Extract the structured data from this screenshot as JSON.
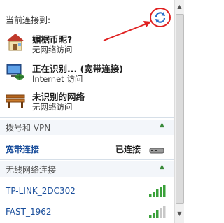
{
  "header": {
    "title": "当前连接到:"
  },
  "connections": [
    {
      "name": "媚椐币昵?",
      "status": "无网络访问",
      "icon": "house-icon"
    },
    {
      "name": "正在识别... (宽带连接)",
      "status": "Internet 访问",
      "icon": "network-computer-icon"
    },
    {
      "name": "未识别的网络",
      "status": "无网络访问",
      "icon": "bench-icon"
    }
  ],
  "dialup": {
    "section_label": "拨号和 VPN",
    "item_name": "宽带连接",
    "item_status": "已连接"
  },
  "wireless": {
    "section_label": "无线网络连接",
    "networks": [
      {
        "name": "TP-LINK_2DC302",
        "signal_level": 5
      },
      {
        "name": "FAST_1962",
        "signal_level": 3
      }
    ]
  },
  "colors": {
    "link_blue": "#1b4f9c",
    "annotation_red": "#e02020",
    "chevron_green": "#3a8a3a",
    "signal_green": "#3aa13a"
  }
}
